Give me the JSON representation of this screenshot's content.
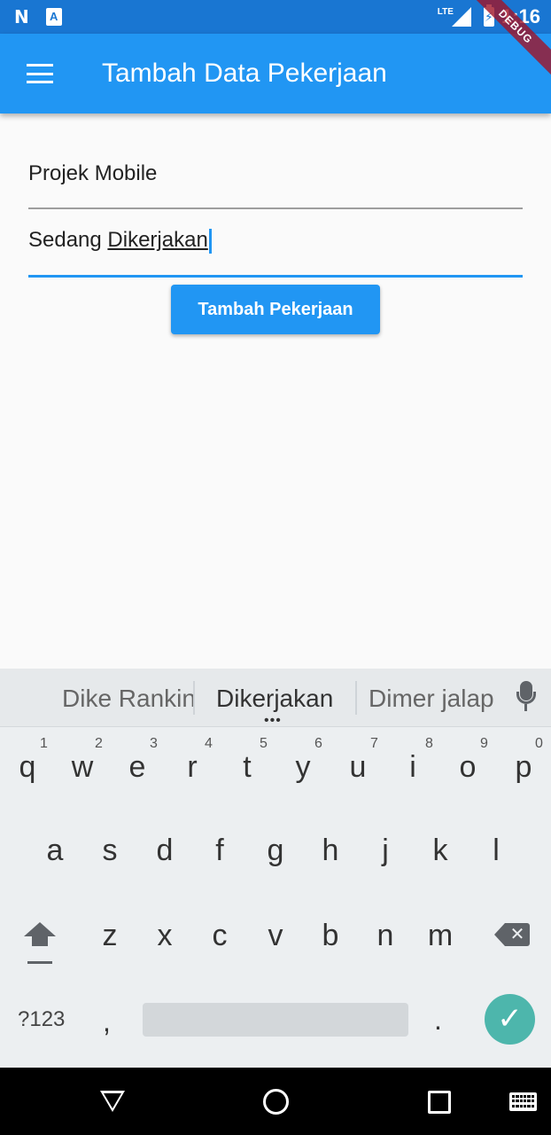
{
  "status_bar": {
    "left_icons": [
      "n-logo-icon",
      "a-notification-icon"
    ],
    "n_logo": "N",
    "a_icon": "A",
    "network": "LTE",
    "time": "1:16"
  },
  "debug_banner": "DEBUG",
  "app_bar": {
    "title": "Tambah Data Pekerjaan",
    "menu_icon": "hamburger-menu-icon"
  },
  "form": {
    "field1_value": "Projek Mobile",
    "field2_prefix": "Sedang ",
    "field2_underlined": "Dikerjakan",
    "submit_label": "Tambah Pekerjaan"
  },
  "keyboard": {
    "suggestions": [
      "Dike Rankin",
      "Dikerjakan",
      "Dimer jalap"
    ],
    "suggestion_more": "•••",
    "row1": [
      "q",
      "w",
      "e",
      "r",
      "t",
      "y",
      "u",
      "i",
      "o",
      "p"
    ],
    "row1_hints": [
      "1",
      "2",
      "3",
      "4",
      "5",
      "6",
      "7",
      "8",
      "9",
      "0"
    ],
    "row2": [
      "a",
      "s",
      "d",
      "f",
      "g",
      "h",
      "j",
      "k",
      "l"
    ],
    "row3": [
      "z",
      "x",
      "c",
      "v",
      "b",
      "n",
      "m"
    ],
    "symbols_label": "?123",
    "comma": ",",
    "period": ".",
    "enter_icon": "✓",
    "backspace_icon": "✕"
  },
  "colors": {
    "status_bar": "#1976d2",
    "app_bar": "#2196f3",
    "accent": "#2196f3",
    "enter_key": "#4db6ac"
  }
}
